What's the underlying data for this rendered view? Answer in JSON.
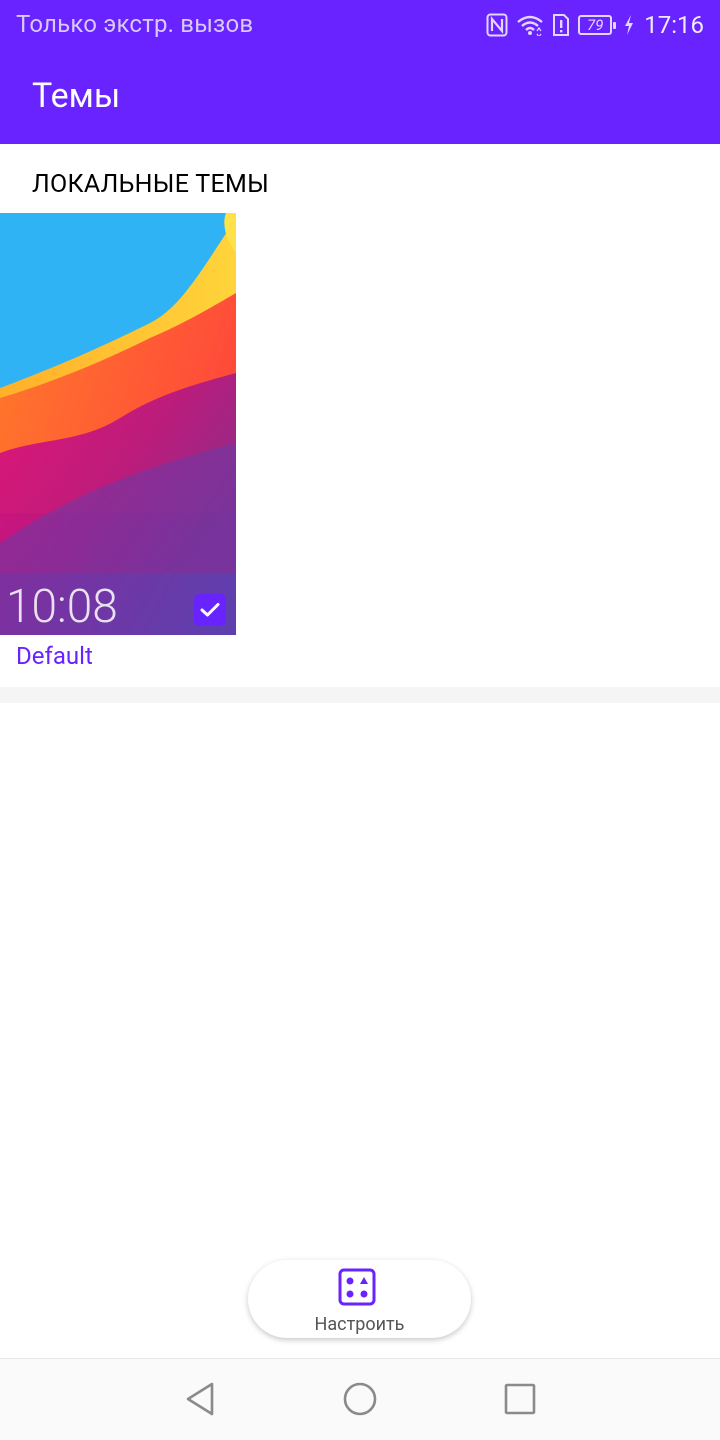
{
  "status_bar": {
    "carrier": "Только экстр. вызов",
    "battery": "79",
    "time": "17:16",
    "icons": [
      "nfc-icon",
      "wifi-icon",
      "sim-alert-icon",
      "battery-icon",
      "charging-icon"
    ]
  },
  "app_bar": {
    "title": "Темы"
  },
  "section": {
    "title": "ЛОКАЛЬНЫЕ ТЕМЫ"
  },
  "themes": [
    {
      "name": "Default",
      "preview_time": "10:08",
      "selected": true
    }
  ],
  "customize": {
    "label": "Настроить",
    "icon": "customize-icon"
  },
  "nav": {
    "icons": [
      "back-icon",
      "home-icon",
      "recents-icon"
    ]
  },
  "colors": {
    "accent": "#6923ff",
    "status_text": "#d8c9ff",
    "theme_label": "#6923ff"
  }
}
